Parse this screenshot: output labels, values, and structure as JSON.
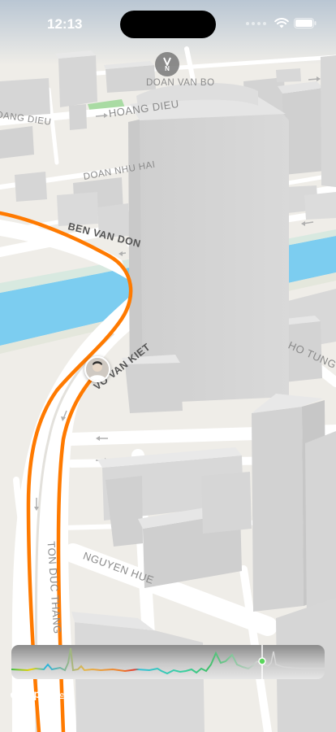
{
  "status_bar": {
    "time": "12:13"
  },
  "compass": {
    "letter": "N"
  },
  "streets": {
    "doan_van_bo": "DOAN VAN BO",
    "hoang_dieu_left": "HOANG DIEU",
    "hoang_dieu_center": "HOANG DIEU",
    "doan_nhu_hai": "DOAN NHU HAI",
    "ben_van_don": "BEN VAN DON",
    "vo_van_kiet": "VO VAN KIET",
    "ho_tung": "HO TUNG",
    "nguyen_hue": "NGUYEN HUE",
    "ton_duc_thang": "TON DUC THANG"
  },
  "attribution": {
    "maps_label": "Maps",
    "legal_label": "Legal"
  },
  "colors": {
    "route": "#ff7a00",
    "water": "#7ccdf0",
    "road": "#ffffff",
    "land": "#efede8",
    "building": "#d9d9d9",
    "park": "#a9dba3"
  },
  "elevation_profile": {
    "progress": 0.8,
    "scrubber_color": "#59d65b"
  }
}
